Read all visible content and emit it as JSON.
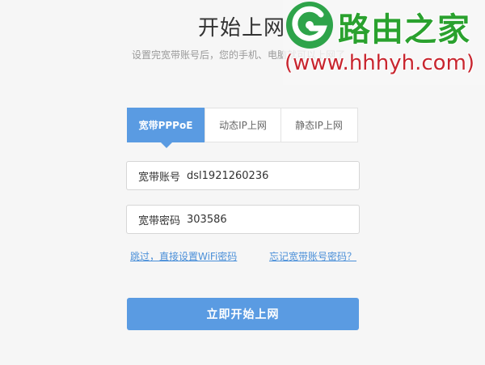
{
  "page": {
    "title": "开始上网",
    "subtitle": "设置完宽带账号后，您的手机、电脑就可以上网了"
  },
  "tabs": [
    {
      "label": "宽带PPPoE",
      "active": true
    },
    {
      "label": "动态IP上网",
      "active": false
    },
    {
      "label": "静态IP上网",
      "active": false
    }
  ],
  "form": {
    "account_label": "宽带账号",
    "account_value": "dsl1921260236",
    "password_label": "宽带密码",
    "password_value": "303586"
  },
  "links": {
    "skip": "跳过，直接设置WiFi密码",
    "forgot": "忘记宽带账号密码？"
  },
  "primary_button": "立即开始上网",
  "watermark": {
    "name": "路由之家",
    "url": "(www.hhhyh.com)"
  },
  "colors": {
    "accent": "#5a9be2",
    "link": "#4a8fd8",
    "watermark_green": "#2aa12e",
    "watermark_red": "#c8262f"
  }
}
